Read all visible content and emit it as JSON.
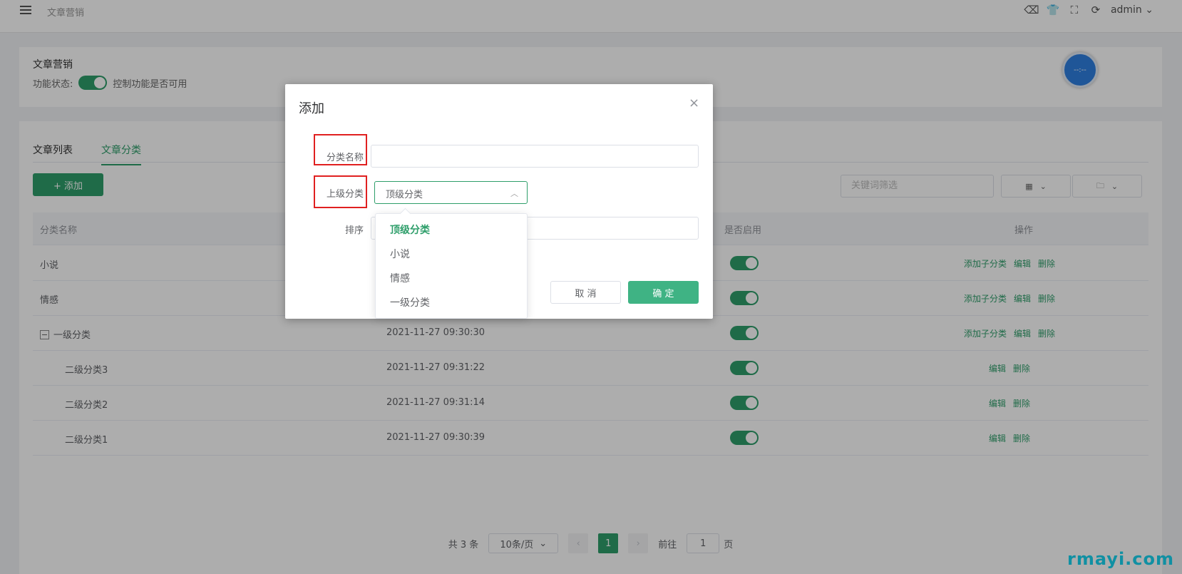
{
  "topbar": {
    "breadcrumb": "文章营销",
    "user": "admin"
  },
  "module": {
    "title": "文章营销",
    "status_label": "功能状态:",
    "status_desc": "控制功能是否可用",
    "clock_text": "--:--"
  },
  "tabs": [
    {
      "label": "文章列表"
    },
    {
      "label": "文章分类"
    }
  ],
  "toolbar": {
    "add_label": "+ 添加",
    "keyword_placeholder": "关键词筛选"
  },
  "table": {
    "headers": [
      "分类名称",
      "是否启用",
      "操作"
    ],
    "rows": [
      {
        "name": "小说",
        "time": "",
        "ops": [
          "添加子分类",
          "编辑",
          "删除"
        ]
      },
      {
        "name": "情感",
        "time": "",
        "ops": [
          "添加子分类",
          "编辑",
          "删除"
        ]
      },
      {
        "name": "一级分类",
        "time": "2021-11-27 09:30:30",
        "ops": [
          "添加子分类",
          "编辑",
          "删除"
        ]
      },
      {
        "name": "二级分类3",
        "time": "2021-11-27 09:31:22",
        "ops": [
          "编辑",
          "删除"
        ]
      },
      {
        "name": "二级分类2",
        "time": "2021-11-27 09:31:14",
        "ops": [
          "编辑",
          "删除"
        ]
      },
      {
        "name": "二级分类1",
        "time": "2021-11-27 09:30:39",
        "ops": [
          "编辑",
          "删除"
        ]
      }
    ]
  },
  "pager": {
    "total": "共 3 条",
    "size": "10条/页",
    "current": "1",
    "goto_label": "前往",
    "goto_value": "1",
    "page_suffix": "页"
  },
  "dialog": {
    "title": "添加",
    "close": "×",
    "name_label": "分类名称",
    "name_value": "",
    "parent_label": "上级分类",
    "parent_value": "顶级分类",
    "sort_label": "排序",
    "cancel_label": "取 消",
    "ok_label": "确 定"
  },
  "dropdown": {
    "options": [
      "顶级分类",
      "小说",
      "情感",
      "一级分类"
    ],
    "selected": "顶级分类"
  },
  "watermark": "rmayi.com",
  "colors": {
    "accent": "#2e9e6a",
    "highlight_box": "#e02020"
  }
}
